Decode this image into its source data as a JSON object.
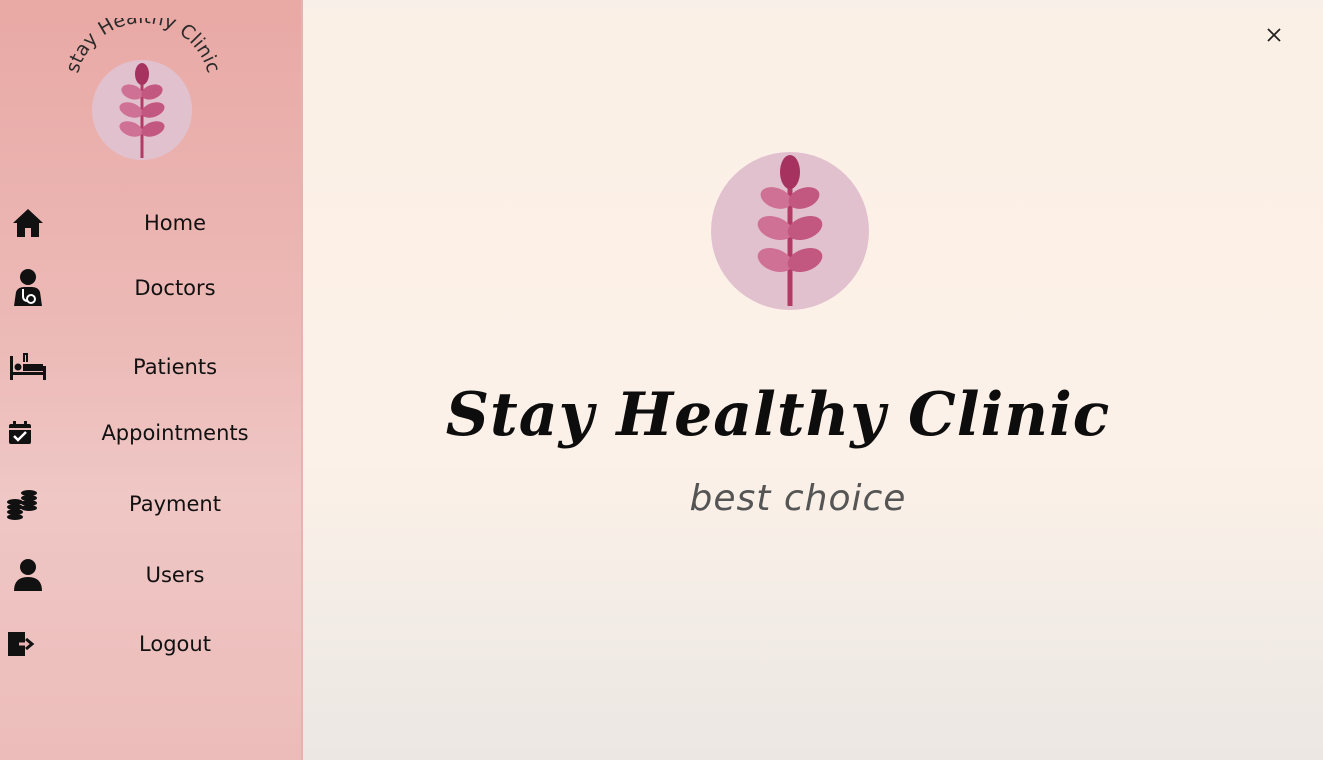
{
  "app": {
    "brand_arc_text": "stay Healthy Clinic",
    "title": "Stay Healthy Clinic",
    "tagline": "best choice"
  },
  "colors": {
    "sidebar": "#ecb8b5",
    "main_bg": "#fbf0e7",
    "logo_circle": "#e2c1cf",
    "leaf_dark": "#c2577f",
    "leaf_light": "#cf7194",
    "stem": "#b43a66"
  },
  "sidebar": {
    "items": [
      {
        "label": "Home",
        "icon": "home-icon"
      },
      {
        "label": "Doctors",
        "icon": "doctor-icon"
      },
      {
        "label": "Patients",
        "icon": "bed-icon"
      },
      {
        "label": "Appointments",
        "icon": "calendar-check-icon"
      },
      {
        "label": "Payment",
        "icon": "coins-icon"
      },
      {
        "label": "Users",
        "icon": "user-icon"
      },
      {
        "label": "Logout",
        "icon": "logout-icon"
      }
    ]
  },
  "window": {
    "close_icon": "close-icon"
  }
}
